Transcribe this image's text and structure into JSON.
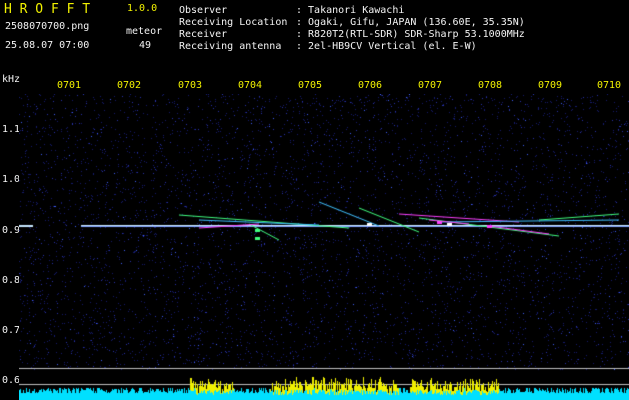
{
  "header": {
    "brand": "H R O F F T",
    "version": "1.0.0",
    "filename": "2508070700.png",
    "datetime": "25.08.07 07:00",
    "count_label": "meteor",
    "count_value": "49",
    "info_rows": [
      {
        "label": "Observer",
        "value": ": Takanori Kawachi"
      },
      {
        "label": "Receiving Location",
        "value": ": Ogaki, Gifu, JAPAN (136.60E, 35.35N)"
      },
      {
        "label": "Receiver",
        "value": ": R820T2(RTL-SDR) SDR-Sharp 53.1000MHz"
      },
      {
        "label": "Receiving antenna",
        "value": ": 2el-HB9CV Vertical (el. E-W)"
      }
    ]
  },
  "spectrogram": {
    "y_unit": "kHz",
    "y_ticks": [
      "1.1",
      "1.0",
      "0.9",
      "0.8",
      "0.7",
      "0.6"
    ],
    "y_tick_values": [
      1.1,
      1.0,
      0.9,
      0.8,
      0.7,
      0.6
    ],
    "y_range": [
      0.58,
      1.2
    ],
    "x_ticks": [
      "0701",
      "0702",
      "0703",
      "0704",
      "0705",
      "0706",
      "0707",
      "0708",
      "0709",
      "0710"
    ],
    "carrier_khz": 0.91,
    "colors": {
      "background": "#000000",
      "noise": "#2a34a8",
      "carrier": "#c8e8ff",
      "echo_hot": "#ff40ff",
      "echo_mid": "#40ff80",
      "echo_cool": "#40c0ff",
      "level_bar": "#00e0ff",
      "level_peak": "#f0f000",
      "baseline": "#c0c0c0"
    }
  }
}
